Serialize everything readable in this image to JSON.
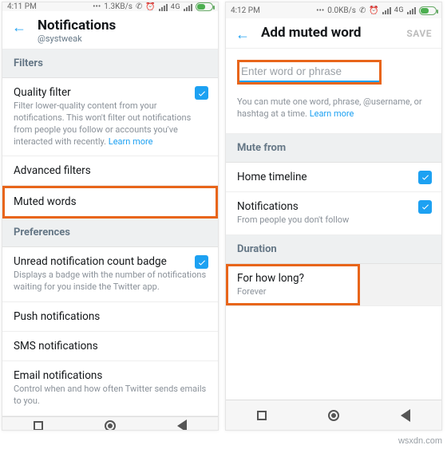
{
  "watermark": "wsxdn.com",
  "left": {
    "status": {
      "time": "4:11 PM",
      "speed": "1.3KB/s",
      "net": "4G",
      "batt": "49"
    },
    "header": {
      "title": "Notifications",
      "subtitle": "@systweak"
    },
    "filters_head": "Filters",
    "quality": {
      "title": "Quality filter",
      "sub": "Filter lower-quality content from your notifications. This won't filter out notifications from people you follow or accounts you've interacted with recently.",
      "learn": "Learn more"
    },
    "advanced": "Advanced filters",
    "muted": "Muted words",
    "prefs_head": "Preferences",
    "unread": {
      "title": "Unread notification count badge",
      "sub": "Displays a badge with the number of notifications waiting for you inside the Twitter app."
    },
    "push": "Push notifications",
    "sms": "SMS notifications",
    "email": {
      "title": "Email notifications",
      "sub": "Control when and how often Twitter sends emails to you."
    }
  },
  "right": {
    "status": {
      "time": "4:12 PM",
      "speed": "0.0KB/s",
      "net": "4G",
      "batt": "49"
    },
    "header": {
      "title": "Add muted word",
      "save": "SAVE"
    },
    "placeholder": "Enter word or phrase",
    "hint": "You can mute one word, phrase, @username, or hashtag at a time.",
    "hint_learn": "Learn more",
    "mute_head": "Mute from",
    "home": "Home timeline",
    "notifs": {
      "title": "Notifications",
      "sub": "From people you don't follow"
    },
    "dur_head": "Duration",
    "how": {
      "title": "For how long?",
      "sub": "Forever"
    }
  }
}
